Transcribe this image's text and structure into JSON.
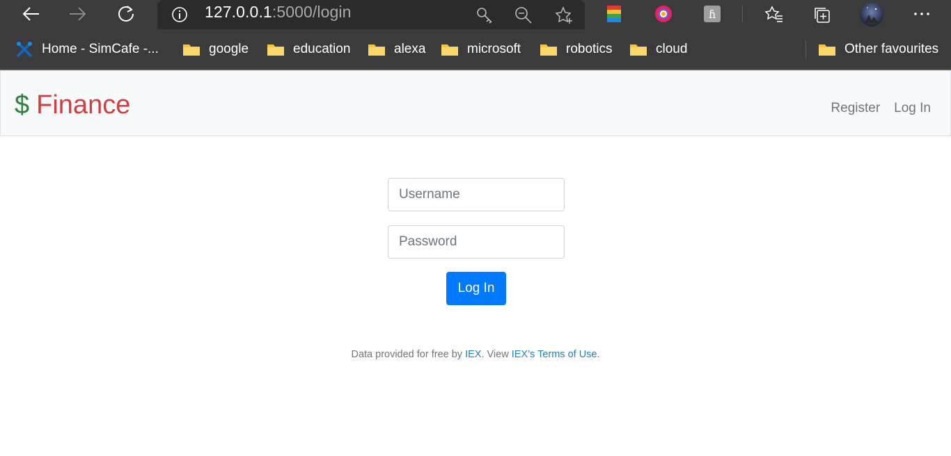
{
  "browser": {
    "url_host": "127.0.0.1",
    "url_path": ":5000/login",
    "bookmarks": [
      "Home - SimCafe -...",
      "google",
      "education",
      "alexa",
      "microsoft",
      "robotics",
      "cloud"
    ],
    "other_favourites": "Other favourites",
    "icons": [
      "back-icon",
      "forward-icon",
      "refresh-icon",
      "info-icon",
      "key-icon",
      "zoom-out-icon",
      "star-add-icon",
      "extension-icon",
      "favourites-icon",
      "collections-icon",
      "profile-avatar",
      "more-icon"
    ]
  },
  "navbar": {
    "brand_symbol": "$",
    "brand_text": "Finance",
    "register_label": "Register",
    "login_label": "Log In"
  },
  "form": {
    "username_placeholder": "Username",
    "password_placeholder": "Password",
    "submit_label": "Log In"
  },
  "footer": {
    "text_1": "Data provided for free by ",
    "link_iex": "IEX",
    "text_2": ". View ",
    "link_terms": "IEX’s Terms of Use",
    "text_3": "."
  },
  "colors": {
    "brand_dollar": "#28843d",
    "brand_finance": "#d23f3f",
    "primary": "#007bff",
    "chrome": "#3b3b3b"
  }
}
